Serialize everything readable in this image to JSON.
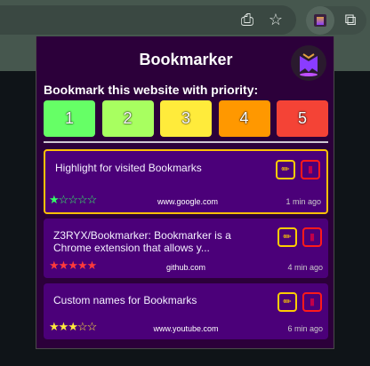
{
  "browser": {
    "icons": [
      "install-app-icon",
      "bookmark-star-icon",
      "bookmarker-extension-icon",
      "extensions-puzzle-icon"
    ]
  },
  "popup": {
    "title": "Bookmarker",
    "prompt": "Bookmark this website with priority:",
    "priorities": [
      {
        "label": "1",
        "color": "#66ff66"
      },
      {
        "label": "2",
        "color": "#a8ff60"
      },
      {
        "label": "3",
        "color": "#ffeb3b"
      },
      {
        "label": "4",
        "color": "#ff9800"
      },
      {
        "label": "5",
        "color": "#f44336"
      }
    ],
    "bookmarks": [
      {
        "title": "Highlight for visited Bookmarks",
        "url": "www.google.com",
        "time": "1 min ago",
        "priority": 1,
        "star_color": "#33ff66",
        "visited": true
      },
      {
        "title": "Z3RYX/Bookmarker: Bookmarker is a Chrome extension that allows y...",
        "url": "github.com",
        "time": "4 min ago",
        "priority": 5,
        "star_color": "#ff3b3b",
        "visited": false
      },
      {
        "title": "Custom names for Bookmarks",
        "url": "www.youtube.com",
        "time": "6 min ago",
        "priority": 3,
        "star_color": "#ffeb3b",
        "visited": false
      }
    ]
  }
}
